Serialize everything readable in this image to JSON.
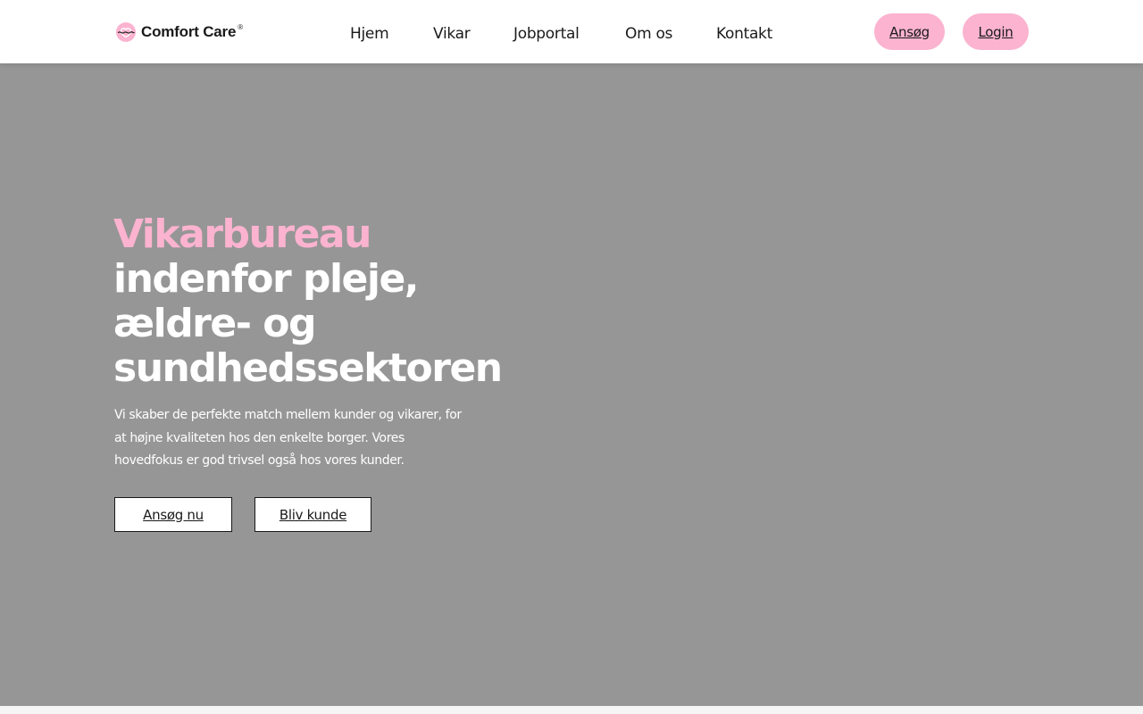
{
  "brand": {
    "name": "Comfort Care",
    "registered_mark": "®",
    "accent_color": "#fbb3cf",
    "logo_icon": "heart-wave-icon"
  },
  "nav": {
    "items": [
      {
        "label": "Hjem"
      },
      {
        "label": "Vikar"
      },
      {
        "label": "Jobportal"
      },
      {
        "label": "Om os"
      },
      {
        "label": "Kontakt"
      }
    ]
  },
  "header_actions": {
    "apply_label": "Ansøg",
    "login_label": "Login"
  },
  "hero": {
    "title_accent": "Vikarbureau",
    "title_rest": "indenfor pleje, ældre- og sundhedssektoren",
    "description": "Vi skaber de perfekte match mellem kunder og vikarer, for at højne kvaliteten hos den enkelte borger. Vores hovedfokus er god trivsel også hos vores kunder.",
    "primary_button": "Ansøg nu",
    "secondary_button": "Bliv kunde",
    "background_color": "#969696"
  }
}
